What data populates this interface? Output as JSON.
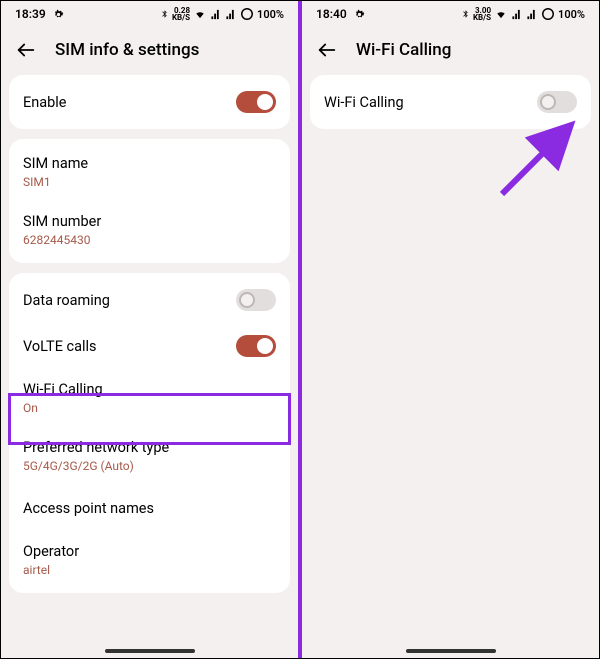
{
  "left": {
    "status": {
      "time": "18:39",
      "net_speed": "0.28",
      "net_unit": "KB/S",
      "battery": "100%"
    },
    "header": {
      "title": "SIM info & settings"
    },
    "card1": {
      "enable": {
        "label": "Enable",
        "on": true
      }
    },
    "card2": {
      "sim_name": {
        "label": "SIM name",
        "value": "SIM1"
      },
      "sim_number": {
        "label": "SIM number",
        "value": "6282445430"
      }
    },
    "card3": {
      "data_roaming": {
        "label": "Data roaming",
        "on": false
      },
      "volte": {
        "label": "VoLTE calls",
        "on": true
      },
      "wifi_calling": {
        "label": "Wi-Fi Calling",
        "value": "On"
      },
      "preferred": {
        "label": "Preferred network type",
        "value": "5G/4G/3G/2G (Auto)"
      },
      "apn": {
        "label": "Access point names"
      },
      "operator": {
        "label": "Operator",
        "value": "airtel"
      }
    }
  },
  "right": {
    "status": {
      "time": "18:40",
      "net_speed": "3.00",
      "net_unit": "KB/S",
      "battery": "100%"
    },
    "header": {
      "title": "Wi-Fi Calling"
    },
    "card1": {
      "wifi_calling": {
        "label": "Wi-Fi Calling",
        "on": false
      }
    }
  }
}
